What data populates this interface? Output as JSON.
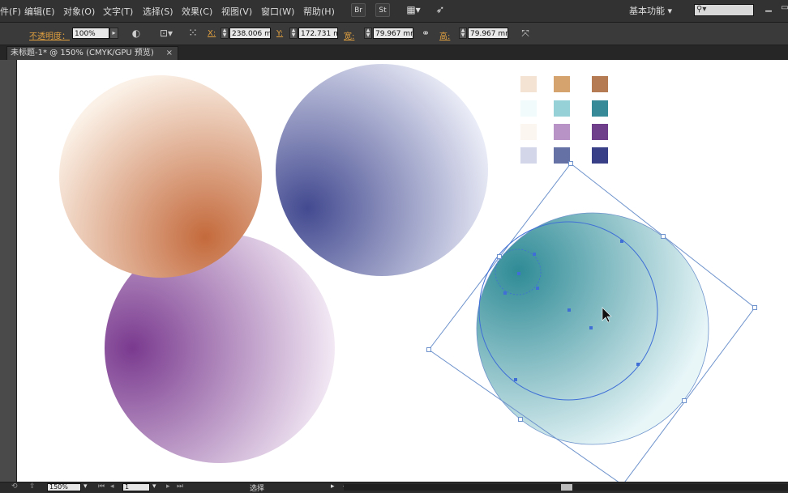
{
  "menubar": {
    "items": [
      "件(F)",
      "编辑(E)",
      "对象(O)",
      "文字(T)",
      "选择(S)",
      "效果(C)",
      "视图(V)",
      "窗口(W)",
      "帮助(H)"
    ],
    "workspace_label": "基本功能",
    "bridge_label": "Br",
    "stock_label": "St"
  },
  "controlbar": {
    "opacity_label": "不透明度：",
    "opacity_value": "100%",
    "x_label": "X:",
    "x_value": "238.006 m",
    "y_label": "Y:",
    "y_value": "172.731 m",
    "w_label": "宽:",
    "w_value": "79.967 mm",
    "h_label": "高:",
    "h_value": "79.967 mm"
  },
  "document_tab": {
    "title": "未标题-1* @ 150% (CMYK/GPU 预览)",
    "close": "×"
  },
  "statusbar": {
    "zoom": "150%",
    "artboard": "1",
    "tool": "选择"
  },
  "swatches": {
    "colors": [
      [
        "#f4e2d2",
        "#d5a36e",
        "#b57b53"
      ],
      [
        "#f2fbfc",
        "#96d1d8",
        "#378b99"
      ],
      [
        "#fbf7f0",
        "#b894c6",
        "#6f3f8c"
      ],
      [
        "#d3d6e8",
        "#6571a5",
        "#383f87"
      ]
    ]
  },
  "gradients": {
    "orange": {
      "center": "#c46a3c",
      "edge": "#fbf1e7"
    },
    "blue": {
      "center": "#434a90",
      "edge": "#eceef8"
    },
    "purple": {
      "center": "#7a3a8f",
      "edge": "#f8f1f9"
    },
    "teal": {
      "center": "#2f8b96",
      "edge": "#e8f6f8"
    }
  },
  "selection": {
    "color": "#6e93cc",
    "anchor_color": "#3f6fd6"
  }
}
